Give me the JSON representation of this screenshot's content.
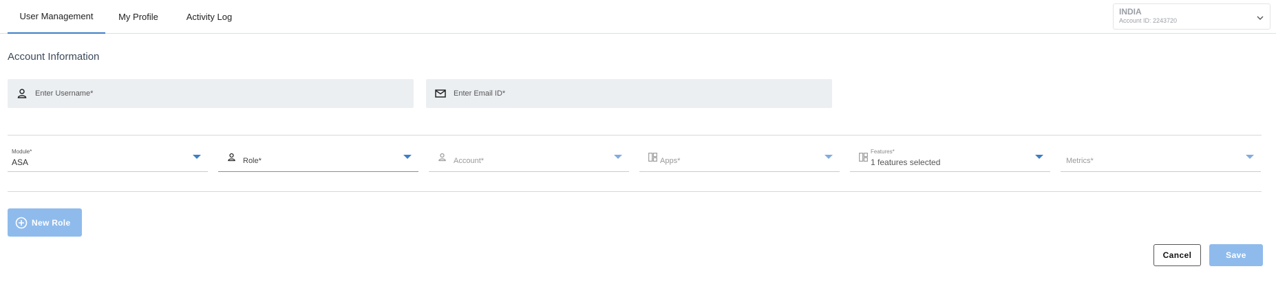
{
  "tabs": [
    {
      "label": "User Management",
      "active": true
    },
    {
      "label": "My Profile",
      "active": false
    },
    {
      "label": "Activity Log",
      "active": false
    }
  ],
  "account_selector": {
    "name": "INDIA",
    "account_id": "Account ID: 2243720",
    "icon": "chevron-down-icon"
  },
  "section_title": "Account Information",
  "fields": {
    "username": {
      "placeholder": "Enter Username*",
      "value": "",
      "icon": "person-icon"
    },
    "email": {
      "placeholder": "Enter Email ID*",
      "value": "",
      "icon": "mail-icon"
    }
  },
  "dropdowns": {
    "module": {
      "label": "Module*",
      "value": "ASA"
    },
    "role": {
      "placeholder": "Role*",
      "value": "",
      "icon": "person-icon"
    },
    "account": {
      "placeholder": "Account*",
      "value": "",
      "icon": "person-icon"
    },
    "apps": {
      "placeholder": "Apps*",
      "value": "",
      "icon": "dashboard-icon"
    },
    "features": {
      "label": "Features*",
      "value": "1 features selected",
      "icon": "dashboard-icon"
    },
    "metrics": {
      "placeholder": "Metrics*",
      "value": ""
    }
  },
  "actions": {
    "new_role": "New Role",
    "cancel": "Cancel",
    "save": "Save"
  },
  "colors": {
    "accent": "#3d7ec8",
    "button_disabled": "#8fbbec",
    "field_bg": "#eceff2"
  }
}
